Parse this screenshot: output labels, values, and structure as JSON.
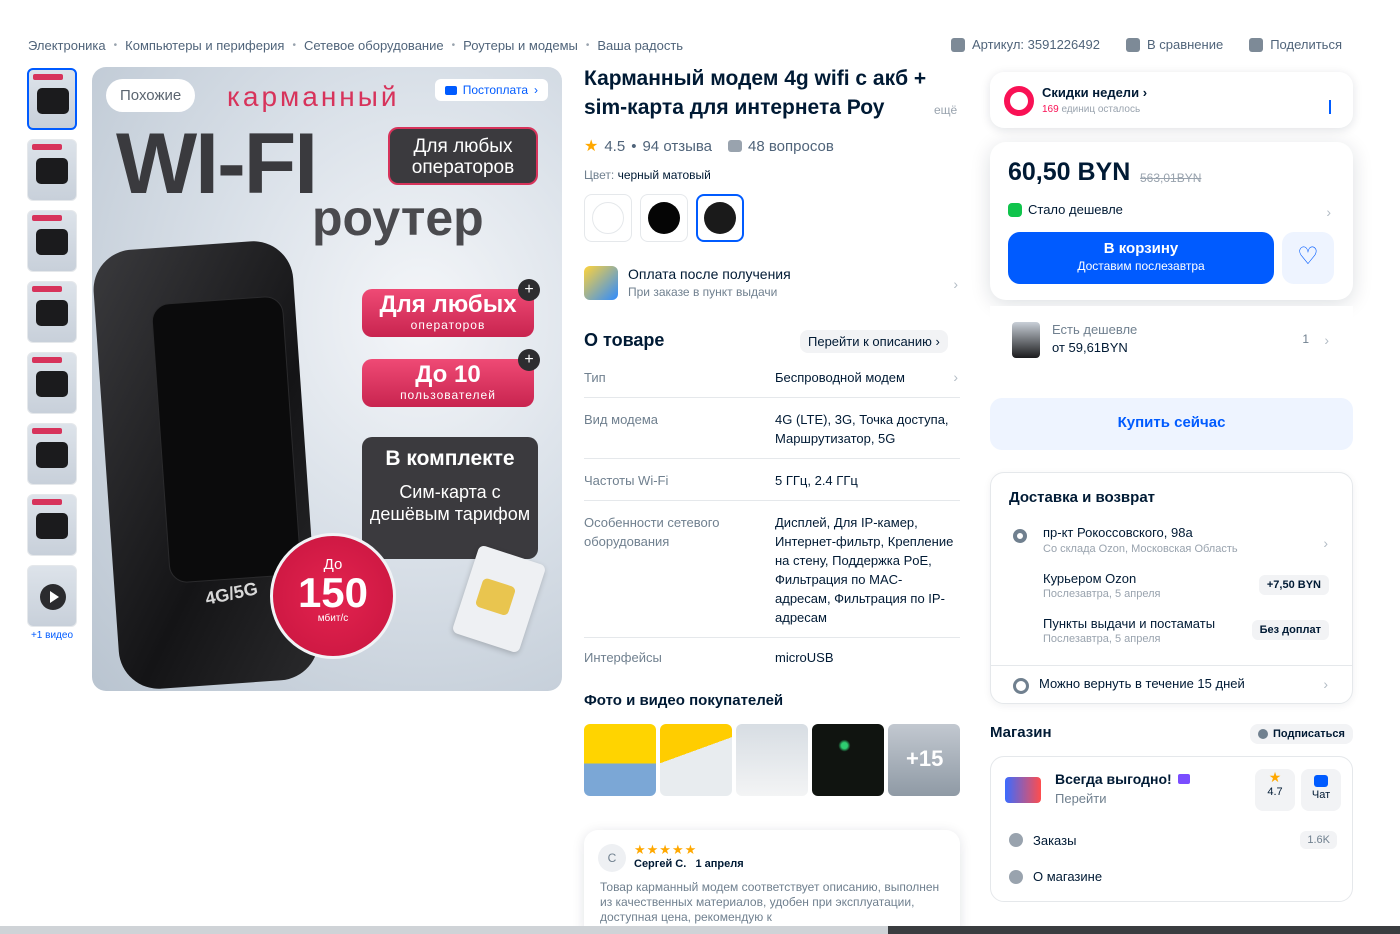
{
  "breadcrumb": [
    "Электроника",
    "Компьютеры и периферия",
    "Сетевое оборудование",
    "Роутеры и модемы",
    "Ваша радость"
  ],
  "top_actions": {
    "article": "Артикул: 3591226492",
    "compare": "В сравнение",
    "share": "Поделиться"
  },
  "gallery": {
    "video_label": "+1 видео",
    "similar": "Похожие",
    "postpay": "Постоплата",
    "image_text": {
      "pocket": "карманный",
      "wifi": "WI-FI",
      "router": "роутер",
      "any_ops": "Для любых операторов",
      "any_ops_big": "Для любых",
      "any_ops_small": "операторов",
      "users_big": "До 10",
      "users_small": "пользователей",
      "kit_head": "В комплекте",
      "kit_body": "Сим-карта с дешёвым тарифом",
      "device_label": "4G/5G",
      "speed_pre": "До",
      "speed_value": "150",
      "speed_unit": "мбит/с"
    }
  },
  "product": {
    "title": "Карманный модем 4g wifi с акб + sim-карта для интернета Роу",
    "more": "ещё",
    "rating": "4.5",
    "reviews": "94 отзыва",
    "questions": "48 вопросов",
    "color_label": "Цвет:",
    "color_value": "черный матовый",
    "swatches": [
      "#ffffff",
      "#050505",
      "#1a1a1a"
    ]
  },
  "payment": {
    "title": "Оплата после получения",
    "subtitle": "При заказе в пункт выдачи"
  },
  "about": {
    "heading": "О товаре",
    "link": "Перейти к описанию",
    "specs": [
      {
        "k": "Тип",
        "v": "Беспроводной модем"
      },
      {
        "k": "Вид модема",
        "v": "4G (LTE), 3G, Точка доступа, Маршрутизатор, 5G"
      },
      {
        "k": "Частоты Wi-Fi",
        "v": "5 ГГц, 2.4 ГГц"
      },
      {
        "k": "Особенности сетевого оборудования",
        "v": "Дисплей, Для IP-камер, Интернет-фильтр, Крепление на стену, Поддержка PoE, Фильтрация по MAC-адресам, Фильтрация по IP-адресам"
      },
      {
        "k": "Интерфейсы",
        "v": "microUSB"
      }
    ]
  },
  "photos": {
    "heading": "Фото и видео покупателей",
    "more_count": "+15"
  },
  "review": {
    "initial": "С",
    "stars": "★★★★★",
    "author": "Сергей С.",
    "date": "1 апреля",
    "text": "Товар карманный модем соответствует описанию, выполнен из качественных материалов, удобен при эксплуатации, доступная цена, рекомендую к"
  },
  "deals": {
    "title": "Скидки недели",
    "count": "169",
    "count_suffix": "единиц осталось"
  },
  "price": {
    "current": "60,50 BYN",
    "old": "563,01BYN",
    "cheaper": "Стало дешевле",
    "cart_title": "В корзину",
    "cart_sub": "Доставим послезавтра",
    "fav_icon": "♡"
  },
  "cheaper_offer": {
    "title": "Есть дешевле",
    "price": "от 59,61BYN",
    "count": "1"
  },
  "buy_now": "Купить сейчас",
  "delivery": {
    "heading": "Доставка и возврат",
    "address": "пр-кт Рокоссовского, 98а",
    "warehouse": "Со склада Ozon, Московская Область",
    "courier": "Курьером Ozon",
    "courier_date": "Послезавтра, 5 апреля",
    "courier_price": "+7,50 BYN",
    "pickup": "Пункты выдачи и постаматы",
    "pickup_date": "Послезавтра, 5 апреля",
    "pickup_price": "Без доплат",
    "return": "Можно вернуть в течение 15 дней"
  },
  "shop": {
    "heading": "Магазин",
    "subscribe": "Подписаться",
    "name": "Всегда выгодно!",
    "go": "Перейти",
    "rating": "4.7",
    "chat": "Чат",
    "orders_label": "Заказы",
    "orders_value": "1.6K",
    "about": "О магазине"
  },
  "colors": {
    "accent": "#005bff",
    "brand_pink": "#f91155",
    "rating_star": "#ffa800",
    "text": "#001a34"
  }
}
